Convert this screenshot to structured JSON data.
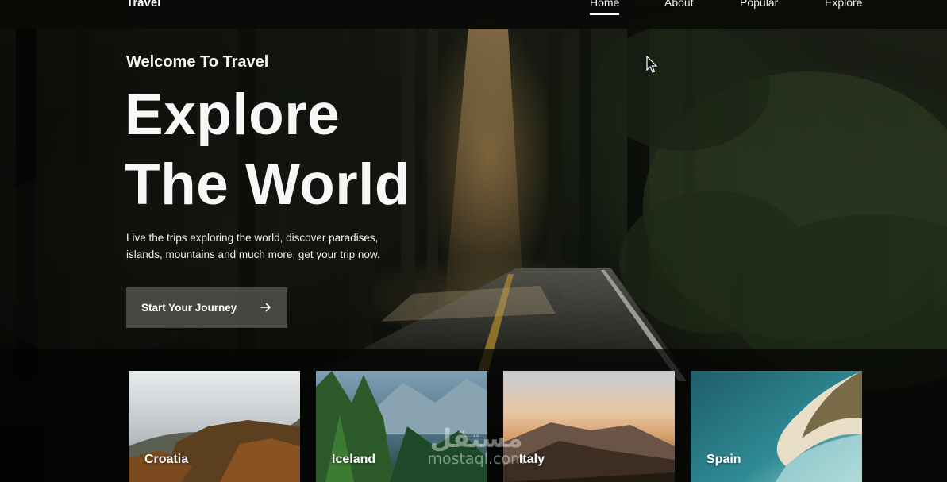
{
  "header": {
    "logo": "Travel",
    "nav": [
      {
        "label": "Home",
        "active": true
      },
      {
        "label": "About",
        "active": false
      },
      {
        "label": "Popular",
        "active": false
      },
      {
        "label": "Explore",
        "active": false
      }
    ]
  },
  "hero": {
    "subtitle": "Welcome To Travel",
    "title_line1": "Explore",
    "title_line2": "The World",
    "description_line1": "Live the trips exploring the world, discover paradises,",
    "description_line2": "islands, mountains and much more, get your trip now.",
    "cta_label": "Start Your Journey",
    "cta_icon": "arrow-right-icon"
  },
  "destinations": [
    {
      "name": "Croatia"
    },
    {
      "name": "Iceland"
    },
    {
      "name": "Italy"
    },
    {
      "name": "Spain"
    }
  ],
  "watermark": {
    "arabic": "مستقل",
    "latin": "mostaql.com"
  },
  "colors": {
    "header_bg": "#0a0a08",
    "button_bg": "#50504c",
    "text": "#ffffff"
  }
}
